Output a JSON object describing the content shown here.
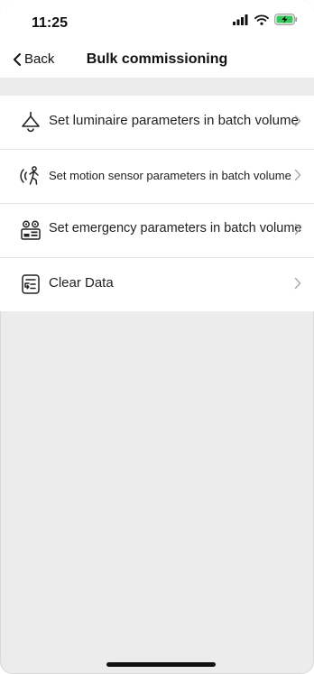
{
  "status": {
    "time": "11:25"
  },
  "nav": {
    "back_label": "Back",
    "title": "Bulk commissioning"
  },
  "rows": [
    {
      "label": "Set luminaire parameters in batch volume",
      "icon": "lamp-icon"
    },
    {
      "label": "Set motion sensor parameters in batch volume",
      "icon": "motion-sensor-icon"
    },
    {
      "label": "Set emergency parameters in batch volume",
      "icon": "emergency-device-icon"
    },
    {
      "label": "Clear Data",
      "icon": "clear-data-icon"
    }
  ]
}
